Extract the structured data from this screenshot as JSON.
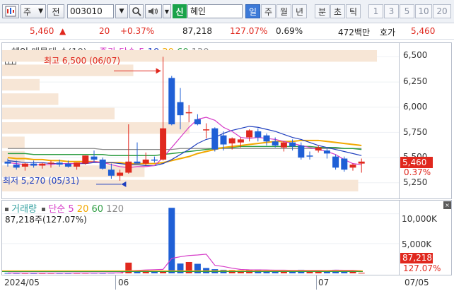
{
  "toolbar": {
    "stock_type": "주",
    "jeon": "전",
    "code": "003010",
    "new_badge": "신",
    "name": "혜인",
    "periods": [
      {
        "label": "일",
        "selected": true
      },
      {
        "label": "주",
        "selected": false
      },
      {
        "label": "월",
        "selected": false
      },
      {
        "label": "년",
        "selected": false
      },
      {
        "label": "분",
        "selected": false
      },
      {
        "label": "초",
        "selected": false
      },
      {
        "label": "틱",
        "selected": false
      }
    ],
    "counts": [
      "1",
      "3",
      "5",
      "10",
      "20"
    ],
    "icons": [
      "dropdown-icon",
      "search-icon",
      "sound-icon"
    ]
  },
  "quote": {
    "price": "5,460",
    "arrow": "▲",
    "change": "20",
    "change_pct": "+0.37%",
    "volume": "87,218",
    "volume_pct": "127.07%",
    "turnover_pct": "0.69%",
    "amount": "472백만",
    "hoga_label": "호가",
    "hoga_value": "5,460"
  },
  "price_panel": {
    "legend": {
      "stock": "혜인",
      "extra": "매물대 수(10)",
      "ma_title": "종가 단순",
      "periods": [
        "5",
        "10",
        "20",
        "60",
        "120"
      ]
    },
    "annotations": {
      "high": "최고 6,500 (06/07)",
      "low": "최저 5,270 (05/31)"
    },
    "current_price": "5,460",
    "current_pct": "0.37%"
  },
  "volume_panel": {
    "legend": {
      "title": "거래량",
      "ma_title": "단순",
      "periods": [
        "5",
        "20",
        "60",
        "120"
      ]
    },
    "summary": "87,218주(127.07%)",
    "current_volume": "87,218",
    "current_pct": "127.07%"
  },
  "colors": {
    "up": "#e0281e",
    "down": "#1f5fd6",
    "ma5": "#d63cc8",
    "ma10": "#1f3fbf",
    "ma20": "#f2a800",
    "ma60": "#2f9e44",
    "ma120": "#8a8a8a",
    "volume_profile": "#f7e6d6"
  },
  "chart_data": [
    {
      "type": "candlestick",
      "title": "혜인",
      "ylim": [
        5150,
        6580
      ],
      "y_ticks": [
        "6,500",
        "6,250",
        "6,000",
        "5,750",
        "5,500",
        "5,250"
      ],
      "x_ticks": [
        "2024/05",
        "06",
        "07",
        "07/05"
      ],
      "candles": [
        {
          "o": 5460,
          "h": 5490,
          "l": 5410,
          "c": 5440
        },
        {
          "o": 5430,
          "h": 5470,
          "l": 5380,
          "c": 5400
        },
        {
          "o": 5410,
          "h": 5450,
          "l": 5370,
          "c": 5440
        },
        {
          "o": 5440,
          "h": 5470,
          "l": 5400,
          "c": 5420
        },
        {
          "o": 5420,
          "h": 5450,
          "l": 5390,
          "c": 5440
        },
        {
          "o": 5440,
          "h": 5470,
          "l": 5400,
          "c": 5450
        },
        {
          "o": 5450,
          "h": 5480,
          "l": 5410,
          "c": 5430
        },
        {
          "o": 5440,
          "h": 5470,
          "l": 5400,
          "c": 5410
        },
        {
          "o": 5410,
          "h": 5450,
          "l": 5380,
          "c": 5450
        },
        {
          "o": 5440,
          "h": 5520,
          "l": 5430,
          "c": 5520
        },
        {
          "o": 5510,
          "h": 5570,
          "l": 5450,
          "c": 5480
        },
        {
          "o": 5480,
          "h": 5500,
          "l": 5380,
          "c": 5390
        },
        {
          "o": 5380,
          "h": 5440,
          "l": 5290,
          "c": 5320
        },
        {
          "o": 5320,
          "h": 5380,
          "l": 5270,
          "c": 5350
        },
        {
          "o": 5350,
          "h": 5830,
          "l": 5340,
          "c": 5460
        },
        {
          "o": 5460,
          "h": 5650,
          "l": 5440,
          "c": 5440
        },
        {
          "o": 5440,
          "h": 5550,
          "l": 5420,
          "c": 5480
        },
        {
          "o": 5480,
          "h": 5510,
          "l": 5450,
          "c": 5470
        },
        {
          "o": 5480,
          "h": 6500,
          "l": 5470,
          "c": 5790
        },
        {
          "o": 6290,
          "h": 6310,
          "l": 5820,
          "c": 5830
        },
        {
          "o": 6050,
          "h": 6190,
          "l": 5780,
          "c": 5920
        },
        {
          "o": 5940,
          "h": 6020,
          "l": 5850,
          "c": 5950
        },
        {
          "o": 5880,
          "h": 5930,
          "l": 5820,
          "c": 5830
        },
        {
          "o": 5780,
          "h": 5840,
          "l": 5690,
          "c": 5780
        },
        {
          "o": 5790,
          "h": 5800,
          "l": 5560,
          "c": 5580
        },
        {
          "o": 5720,
          "h": 5760,
          "l": 5570,
          "c": 5630
        },
        {
          "o": 5640,
          "h": 5700,
          "l": 5580,
          "c": 5690
        },
        {
          "o": 5650,
          "h": 5700,
          "l": 5600,
          "c": 5680
        },
        {
          "o": 5700,
          "h": 5780,
          "l": 5660,
          "c": 5770
        },
        {
          "o": 5760,
          "h": 5790,
          "l": 5660,
          "c": 5700
        },
        {
          "o": 5720,
          "h": 5740,
          "l": 5620,
          "c": 5660
        },
        {
          "o": 5660,
          "h": 5700,
          "l": 5600,
          "c": 5620
        },
        {
          "o": 5600,
          "h": 5660,
          "l": 5560,
          "c": 5650
        },
        {
          "o": 5650,
          "h": 5680,
          "l": 5570,
          "c": 5610
        },
        {
          "o": 5620,
          "h": 5650,
          "l": 5480,
          "c": 5500
        },
        {
          "o": 5520,
          "h": 5560,
          "l": 5480,
          "c": 5510
        },
        {
          "o": 5570,
          "h": 5620,
          "l": 5550,
          "c": 5600
        },
        {
          "o": 5570,
          "h": 5590,
          "l": 5490,
          "c": 5540
        },
        {
          "o": 5510,
          "h": 5530,
          "l": 5380,
          "c": 5400
        },
        {
          "o": 5490,
          "h": 5510,
          "l": 5360,
          "c": 5380
        },
        {
          "o": 5400,
          "h": 5440,
          "l": 5370,
          "c": 5430
        },
        {
          "o": 5440,
          "h": 5490,
          "l": 5350,
          "c": 5460
        }
      ],
      "volume_profile_relative": [
        0.95,
        0.38,
        0.06,
        0.06,
        0.5,
        0.3,
        0.15,
        0.1,
        0.35,
        1.0
      ],
      "moving_averages": [
        {
          "name": "5",
          "values": [
            5450,
            5440,
            5430,
            5430,
            5430,
            5430,
            5440,
            5440,
            5440,
            5450,
            5460,
            5450,
            5430,
            5410,
            5400,
            5410,
            5410,
            5420,
            5500,
            5600,
            5700,
            5800,
            5880,
            5900,
            5870,
            5800,
            5760,
            5700,
            5690,
            5700,
            5690,
            5680,
            5660,
            5640,
            5620,
            5600,
            5580,
            5560,
            5530,
            5480,
            5440,
            5430
          ]
        },
        {
          "name": "10",
          "values": [
            5470,
            5460,
            5450,
            5450,
            5450,
            5440,
            5440,
            5440,
            5440,
            5440,
            5450,
            5450,
            5450,
            5440,
            5430,
            5430,
            5420,
            5420,
            5440,
            5480,
            5530,
            5580,
            5640,
            5680,
            5700,
            5740,
            5770,
            5790,
            5810,
            5800,
            5780,
            5760,
            5730,
            5700,
            5680,
            5650,
            5620,
            5600,
            5580,
            5560,
            5540,
            5520
          ]
        },
        {
          "name": "20",
          "values": [
            5500,
            5490,
            5490,
            5480,
            5480,
            5470,
            5470,
            5460,
            5460,
            5460,
            5460,
            5450,
            5450,
            5450,
            5440,
            5440,
            5440,
            5440,
            5450,
            5470,
            5490,
            5510,
            5540,
            5560,
            5580,
            5600,
            5610,
            5620,
            5630,
            5640,
            5650,
            5660,
            5660,
            5660,
            5670,
            5670,
            5670,
            5660,
            5650,
            5640,
            5630,
            5620
          ]
        },
        {
          "name": "60",
          "values": [
            5540,
            5540,
            5540,
            5530,
            5530,
            5530,
            5530,
            5530,
            5530,
            5530,
            5530,
            5530,
            5520,
            5520,
            5520,
            5520,
            5520,
            5520,
            5530,
            5540,
            5550,
            5560,
            5570,
            5580,
            5590,
            5600,
            5600,
            5610,
            5610,
            5610,
            5610,
            5610,
            5610,
            5610,
            5610,
            5610,
            5600,
            5600,
            5600,
            5590,
            5590,
            5580
          ]
        },
        {
          "name": "120",
          "values": [
            5590,
            5590,
            5590,
            5590,
            5590,
            5590,
            5590,
            5590,
            5590,
            5590,
            5590,
            5580,
            5580,
            5580,
            5580,
            5580,
            5580,
            5580,
            5580,
            5580,
            5590,
            5590,
            5590,
            5590,
            5590,
            5590,
            5590,
            5590,
            5590,
            5590,
            5590,
            5590,
            5590,
            5590,
            5590,
            5590,
            5590,
            5590,
            5590,
            5590,
            5590,
            5590
          ]
        }
      ]
    },
    {
      "type": "bar",
      "title": "거래량",
      "ylim": [
        0,
        11500
      ],
      "y_ticks": [
        "10,000K",
        "5,000K"
      ],
      "values": [
        60,
        50,
        55,
        45,
        50,
        60,
        55,
        50,
        60,
        70,
        80,
        65,
        90,
        120,
        1800,
        350,
        500,
        300,
        400,
        11000,
        1650,
        1900,
        1600,
        900,
        700,
        600,
        550,
        500,
        600,
        650,
        500,
        450,
        500,
        450,
        600,
        500,
        450,
        500,
        600,
        550,
        500,
        87.2
      ],
      "up_down": [
        "d",
        "d",
        "u",
        "d",
        "u",
        "u",
        "d",
        "d",
        "u",
        "u",
        "d",
        "d",
        "d",
        "u",
        "u",
        "d",
        "u",
        "d",
        "u",
        "d",
        "d",
        "u",
        "d",
        "d",
        "d",
        "d",
        "u",
        "u",
        "u",
        "d",
        "d",
        "d",
        "u",
        "d",
        "d",
        "u",
        "u",
        "d",
        "d",
        "d",
        "u",
        "u"
      ],
      "ma5": [
        55,
        55,
        53,
        52,
        52,
        54,
        54,
        54,
        55,
        59,
        63,
        66,
        73,
        85,
        427,
        485,
        572,
        614,
        670,
        2510,
        2790,
        2990,
        3080,
        3210,
        1350,
        1150,
        870,
        650,
        590,
        580,
        560,
        540,
        540,
        510,
        500,
        500,
        500,
        480,
        530,
        520,
        520,
        440
      ]
    }
  ]
}
